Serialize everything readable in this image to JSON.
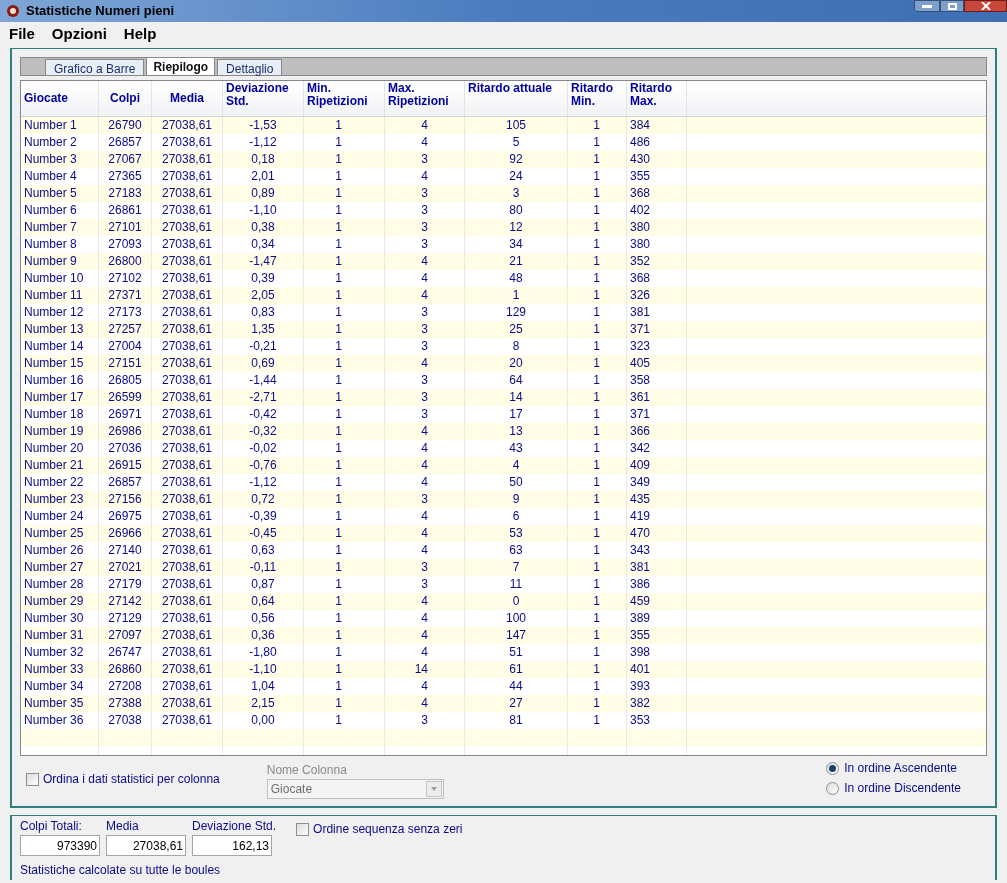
{
  "window": {
    "title": "Statistiche Numeri pieni"
  },
  "menu": [
    {
      "label": "File"
    },
    {
      "label": "Opzioni"
    },
    {
      "label": "Help"
    }
  ],
  "tabs": [
    {
      "label": "Grafico a Barre",
      "selected": false
    },
    {
      "label": "Riepilogo",
      "selected": true
    },
    {
      "label": "Dettaglio",
      "selected": false
    }
  ],
  "table": {
    "columns": [
      "Giocate",
      "Colpi",
      "Media",
      "Deviazione Std.",
      "Min. Ripetizioni",
      "Max. Ripetizioni",
      "Ritardo attuale",
      "Ritardo Min.",
      "Ritardo Max."
    ],
    "rows": [
      [
        "Number 1",
        "26790",
        "27038,61",
        "-1,53",
        "1",
        "4",
        "105",
        "1",
        "384"
      ],
      [
        "Number 2",
        "26857",
        "27038,61",
        "-1,12",
        "1",
        "4",
        "5",
        "1",
        "486"
      ],
      [
        "Number 3",
        "27067",
        "27038,61",
        "0,18",
        "1",
        "3",
        "92",
        "1",
        "430"
      ],
      [
        "Number 4",
        "27365",
        "27038,61",
        "2,01",
        "1",
        "4",
        "24",
        "1",
        "355"
      ],
      [
        "Number 5",
        "27183",
        "27038,61",
        "0,89",
        "1",
        "3",
        "3",
        "1",
        "368"
      ],
      [
        "Number 6",
        "26861",
        "27038,61",
        "-1,10",
        "1",
        "3",
        "80",
        "1",
        "402"
      ],
      [
        "Number 7",
        "27101",
        "27038,61",
        "0,38",
        "1",
        "3",
        "12",
        "1",
        "380"
      ],
      [
        "Number 8",
        "27093",
        "27038,61",
        "0,34",
        "1",
        "3",
        "34",
        "1",
        "380"
      ],
      [
        "Number 9",
        "26800",
        "27038,61",
        "-1,47",
        "1",
        "4",
        "21",
        "1",
        "352"
      ],
      [
        "Number 10",
        "27102",
        "27038,61",
        "0,39",
        "1",
        "4",
        "48",
        "1",
        "368"
      ],
      [
        "Number 11",
        "27371",
        "27038,61",
        "2,05",
        "1",
        "4",
        "1",
        "1",
        "326"
      ],
      [
        "Number 12",
        "27173",
        "27038,61",
        "0,83",
        "1",
        "3",
        "129",
        "1",
        "381"
      ],
      [
        "Number 13",
        "27257",
        "27038,61",
        "1,35",
        "1",
        "3",
        "25",
        "1",
        "371"
      ],
      [
        "Number 14",
        "27004",
        "27038,61",
        "-0,21",
        "1",
        "3",
        "8",
        "1",
        "323"
      ],
      [
        "Number 15",
        "27151",
        "27038,61",
        "0,69",
        "1",
        "4",
        "20",
        "1",
        "405"
      ],
      [
        "Number 16",
        "26805",
        "27038,61",
        "-1,44",
        "1",
        "3",
        "64",
        "1",
        "358"
      ],
      [
        "Number 17",
        "26599",
        "27038,61",
        "-2,71",
        "1",
        "3",
        "14",
        "1",
        "361"
      ],
      [
        "Number 18",
        "26971",
        "27038,61",
        "-0,42",
        "1",
        "3",
        "17",
        "1",
        "371"
      ],
      [
        "Number 19",
        "26986",
        "27038,61",
        "-0,32",
        "1",
        "4",
        "13",
        "1",
        "366"
      ],
      [
        "Number 20",
        "27036",
        "27038,61",
        "-0,02",
        "1",
        "4",
        "43",
        "1",
        "342"
      ],
      [
        "Number 21",
        "26915",
        "27038,61",
        "-0,76",
        "1",
        "4",
        "4",
        "1",
        "409"
      ],
      [
        "Number 22",
        "26857",
        "27038,61",
        "-1,12",
        "1",
        "4",
        "50",
        "1",
        "349"
      ],
      [
        "Number 23",
        "27156",
        "27038,61",
        "0,72",
        "1",
        "3",
        "9",
        "1",
        "435"
      ],
      [
        "Number 24",
        "26975",
        "27038,61",
        "-0,39",
        "1",
        "4",
        "6",
        "1",
        "419"
      ],
      [
        "Number 25",
        "26966",
        "27038,61",
        "-0,45",
        "1",
        "4",
        "53",
        "1",
        "470"
      ],
      [
        "Number 26",
        "27140",
        "27038,61",
        "0,63",
        "1",
        "4",
        "63",
        "1",
        "343"
      ],
      [
        "Number 27",
        "27021",
        "27038,61",
        "-0,11",
        "1",
        "3",
        "7",
        "1",
        "381"
      ],
      [
        "Number 28",
        "27179",
        "27038,61",
        "0,87",
        "1",
        "3",
        "11",
        "1",
        "386"
      ],
      [
        "Number 29",
        "27142",
        "27038,61",
        "0,64",
        "1",
        "4",
        "0",
        "1",
        "459"
      ],
      [
        "Number 30",
        "27129",
        "27038,61",
        "0,56",
        "1",
        "4",
        "100",
        "1",
        "389"
      ],
      [
        "Number 31",
        "27097",
        "27038,61",
        "0,36",
        "1",
        "4",
        "147",
        "1",
        "355"
      ],
      [
        "Number 32",
        "26747",
        "27038,61",
        "-1,80",
        "1",
        "4",
        "51",
        "1",
        "398"
      ],
      [
        "Number 33",
        "26860",
        "27038,61",
        "-1,10",
        "1",
        "14",
        "61",
        "1",
        "401"
      ],
      [
        "Number 34",
        "27208",
        "27038,61",
        "1,04",
        "1",
        "4",
        "44",
        "1",
        "393"
      ],
      [
        "Number 35",
        "27388",
        "27038,61",
        "2,15",
        "1",
        "4",
        "27",
        "1",
        "382"
      ],
      [
        "Number 36",
        "27038",
        "27038,61",
        "0,00",
        "1",
        "3",
        "81",
        "1",
        "353"
      ]
    ]
  },
  "sort_checkbox": {
    "label": "Ordina i dati statistici per colonna",
    "checked": false
  },
  "column_select": {
    "label": "Nome Colonna",
    "value": "Giocate",
    "disabled": true
  },
  "order_radios": [
    {
      "label": "In ordine Ascendente",
      "selected": true
    },
    {
      "label": "In ordine Discendente",
      "selected": false
    }
  ],
  "totals": [
    {
      "label": "Colpi Totali:",
      "value": "973390"
    },
    {
      "label": "Media",
      "value": "27038,61"
    },
    {
      "label": "Deviazione Std.",
      "value": "162,13"
    }
  ],
  "zero_checkbox": {
    "label": "Ordine sequenza senza zeri",
    "checked": false
  },
  "status_note": "Statistiche calcolate su tutte le boules"
}
